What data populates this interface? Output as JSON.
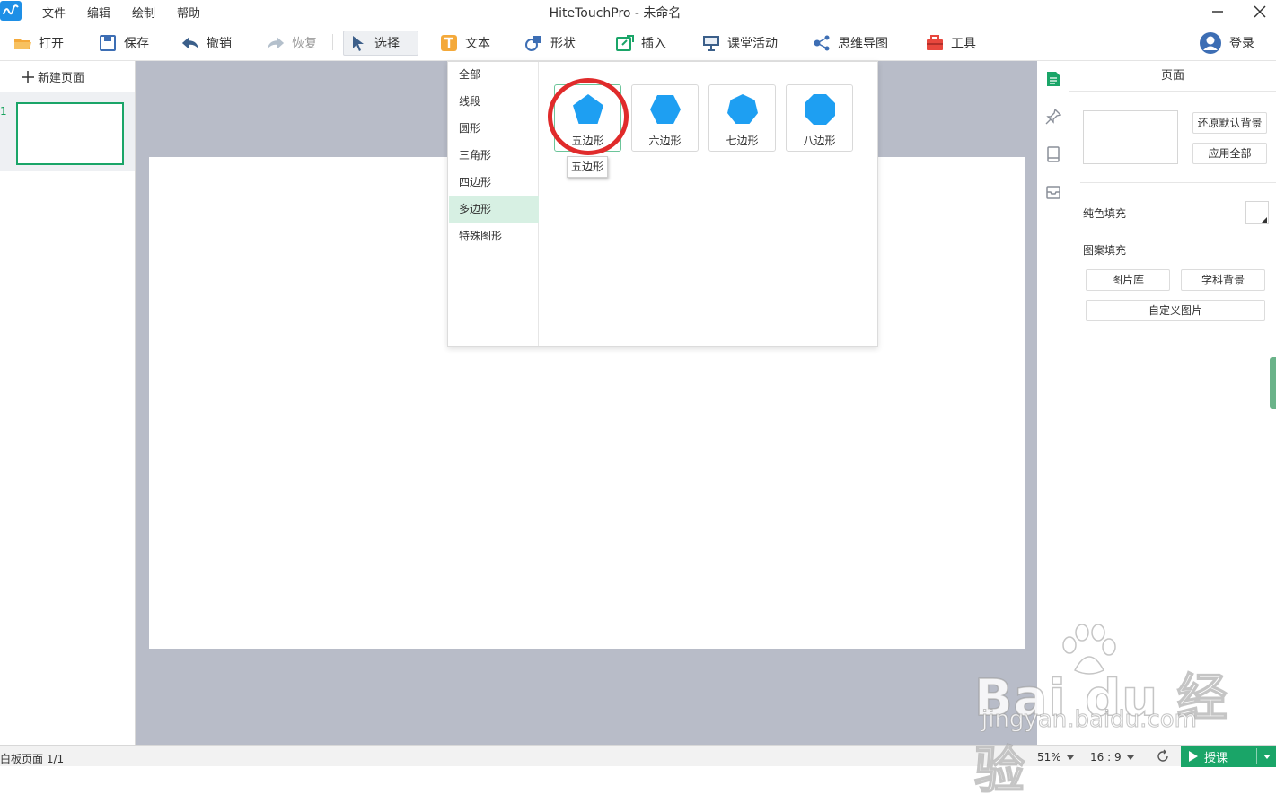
{
  "titlebar": {
    "menus": [
      "文件",
      "编辑",
      "绘制",
      "帮助"
    ],
    "window_title": "HiteTouchPro - 未命名"
  },
  "toolbar": {
    "open": "打开",
    "save": "保存",
    "undo": "撤销",
    "redo": "恢复",
    "select": "选择",
    "text": "文本",
    "shape": "形状",
    "insert": "插入",
    "class_activity": "课堂活动",
    "mind_map": "思维导图",
    "tools": "工具",
    "login": "登录"
  },
  "left_panel": {
    "new_page": "新建页面",
    "page_number": "1"
  },
  "shape_menu": {
    "categories": [
      "全部",
      "线段",
      "圆形",
      "三角形",
      "四边形",
      "多边形",
      "特殊图形"
    ],
    "selected_category": "多边形",
    "shapes": [
      "五边形",
      "六边形",
      "七边形",
      "八边形"
    ],
    "tooltip": "五边形",
    "shape_color": "#1e9ff2"
  },
  "right_panel": {
    "title": "页面",
    "restore_default_bg": "还原默认背景",
    "apply_all": "应用全部",
    "solid_fill": "纯色填充",
    "pattern_fill": "图案填充",
    "image_library": "图片库",
    "subject_bg": "学科背景",
    "custom_image": "自定义图片"
  },
  "statusbar": {
    "page_info": "白板页面 1/1",
    "zoom": "51%",
    "ratio": "16 : 9",
    "start_class": "授课"
  },
  "watermark": {
    "brand": "Bai du 经验",
    "url": "jingyan.baidu.com"
  },
  "colors": {
    "accent": "#1aa568",
    "highlight_circle": "#e02b2b",
    "canvas_bg": "#b8bcc8"
  }
}
